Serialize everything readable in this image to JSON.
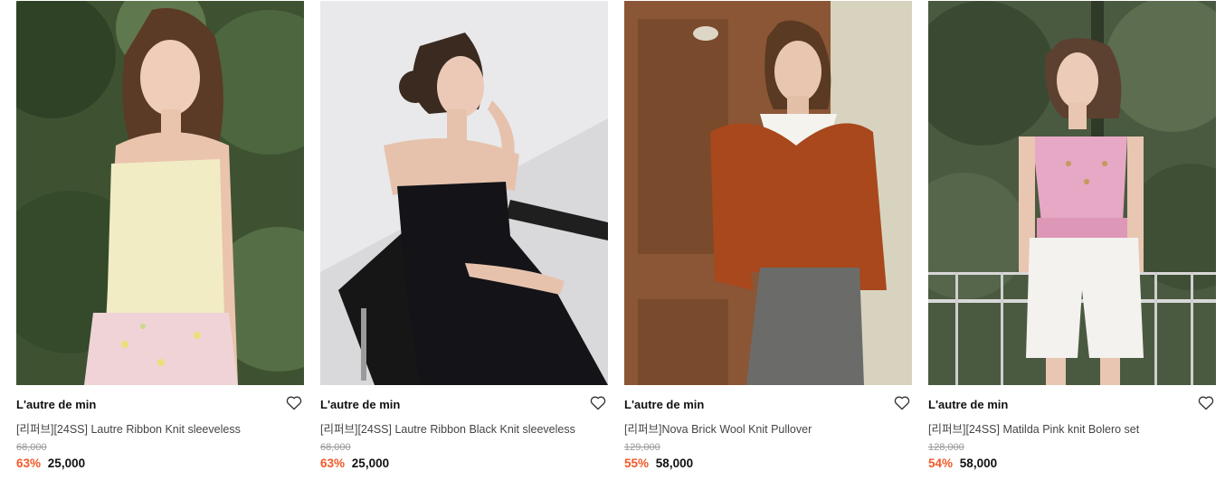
{
  "products": [
    {
      "brand": "L'autre de min",
      "title": "[리퍼브][24SS] Lautre Ribbon Knit sleeveless",
      "original_price": "68,000",
      "discount": "63%",
      "price": "25,000",
      "wishlist_icon": "heart-outline-icon"
    },
    {
      "brand": "L'autre de min",
      "title": "[리퍼브][24SS] Lautre Ribbon Black Knit sleeveless",
      "original_price": "68,000",
      "discount": "63%",
      "price": "25,000",
      "wishlist_icon": "heart-outline-icon"
    },
    {
      "brand": "L'autre de min",
      "title": "[리퍼브]Nova Brick Wool Knit Pullover",
      "original_price": "129,000",
      "discount": "55%",
      "price": "58,000",
      "wishlist_icon": "heart-outline-icon"
    },
    {
      "brand": "L'autre de min",
      "title": "[리퍼브][24SS] Matilda Pink knit Bolero set",
      "original_price": "128,000",
      "discount": "54%",
      "price": "58,000",
      "wishlist_icon": "heart-outline-icon"
    }
  ],
  "colors": {
    "discount": "#f05a28",
    "original_price": "#999999",
    "brand": "#111111"
  }
}
